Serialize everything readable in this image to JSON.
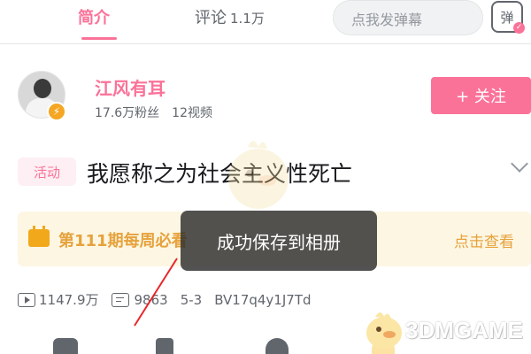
{
  "tabs": {
    "intro": "简介",
    "comments_label": "评论",
    "comments_count": "1.1万"
  },
  "danmaku": {
    "placeholder": "点我发弹幕",
    "toggle_label": "弹",
    "toggle_check": "✓"
  },
  "uploader": {
    "name": "江风有耳",
    "followers": "17.6万粉丝",
    "videos": "12视频",
    "badge": "⚡",
    "follow_label": "+ 关注"
  },
  "video": {
    "tag": "活动",
    "title": "我愿称之为社会主义性死亡"
  },
  "banner": {
    "text": "第111期每周必看",
    "link": "点击查看"
  },
  "toast": {
    "message": "成功保存到相册"
  },
  "stats": {
    "views": "1147.9万",
    "danmaku_count": "9863",
    "date": "5-3",
    "bvid": "BV17q4y1J7Td"
  },
  "watermark": {
    "text": "3DMGAME"
  },
  "colors": {
    "accent": "#fb7299",
    "banner_bg": "#fdf6e3",
    "banner_text": "#e6a23c",
    "toast_bg": "#2c2c2c"
  }
}
